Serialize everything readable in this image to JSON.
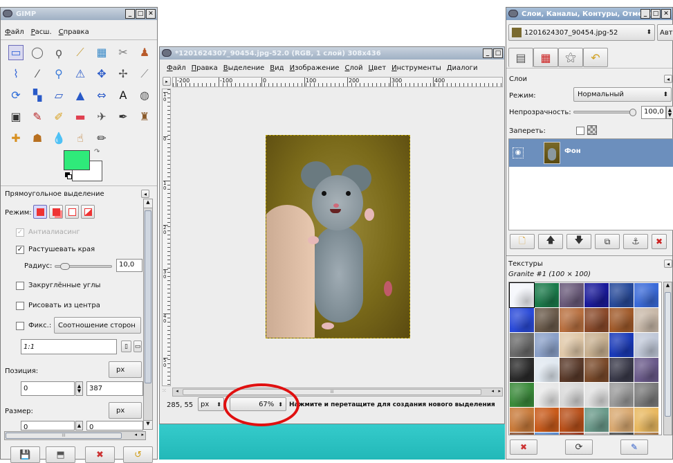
{
  "toolbox": {
    "title": "GIMP",
    "menu": [
      "Файл",
      "Расш.",
      "Справка"
    ],
    "tools": [
      [
        "rect-select-icon",
        "▭"
      ],
      [
        "ellipse-select-icon",
        "◯"
      ],
      [
        "free-select-icon",
        "ϙ"
      ],
      [
        "fuzzy-select-icon",
        "⟋"
      ],
      [
        "color-select-icon",
        "▦"
      ],
      [
        "scissors-icon",
        "✂"
      ],
      [
        "foreground-select-icon",
        "♟"
      ],
      [
        "paths-icon",
        "⌇"
      ],
      [
        "color-picker-icon",
        "⁄"
      ],
      [
        "zoom-icon",
        "⚲"
      ],
      [
        "measure-icon",
        "⚠"
      ],
      [
        "move-icon",
        "✥"
      ],
      [
        "align-icon",
        "✢"
      ],
      [
        "crop-icon",
        "⟋"
      ],
      [
        "rotate-icon",
        "⟳"
      ],
      [
        "scale-icon",
        "▚"
      ],
      [
        "shear-icon",
        "▱"
      ],
      [
        "perspective-icon",
        "▲"
      ],
      [
        "flip-icon",
        "⇔"
      ],
      [
        "text-icon",
        "A"
      ],
      [
        "bucket-fill-icon",
        "◍"
      ],
      [
        "blend-icon",
        "▣"
      ],
      [
        "pencil-icon",
        "✎"
      ],
      [
        "paintbrush-icon",
        "✐"
      ],
      [
        "eraser-icon",
        "▬"
      ],
      [
        "airbrush-icon",
        "✈"
      ],
      [
        "ink-icon",
        "✒"
      ],
      [
        "clone-icon",
        "♜"
      ],
      [
        "heal-icon",
        "✚"
      ],
      [
        "perspective-clone-icon",
        "☗"
      ],
      [
        "blur-icon",
        "💧"
      ],
      [
        "smudge-icon",
        "☝"
      ],
      [
        "dodge-burn-icon",
        "✏"
      ]
    ],
    "fg_color": "#2fea7a",
    "bg_color": "#ffffff"
  },
  "tool_options": {
    "title": "Прямоугольное выделение",
    "mode_label": "Режим:",
    "antialias_label": "Антиалиасинг",
    "feather_label": "Растушевать края",
    "radius_label": "Радиус:",
    "radius_value": "10,0",
    "radius_fraction": 0.1,
    "rounded_label": "Закруглённые углы",
    "from_center_label": "Рисовать из центра",
    "fixed_label": "Фикс.:",
    "fixed_select": "Соотношение сторон",
    "ratio_value": "1:1",
    "position_label": "Позиция:",
    "position_unit": "px",
    "pos_x": "0",
    "pos_y": "387",
    "size_label": "Размер:",
    "size_unit": "px",
    "size_w": "0",
    "size_h": "0"
  },
  "image_window": {
    "title": "*1201624307_90454.jpg-52.0 (RGB, 1 слой) 308x436",
    "menu": [
      "Файл",
      "Правка",
      "Выделение",
      "Вид",
      "Изображение",
      "Слой",
      "Цвет",
      "Инструменты",
      "Диалоги"
    ],
    "hruler": [
      "-200",
      "-100",
      "0",
      "100",
      "200",
      "300",
      "400"
    ],
    "vruler": [
      "1 0",
      "0",
      "1 0",
      "2 0",
      "3 0",
      "4 0",
      "5 0"
    ],
    "coords": "285, 55",
    "unit": "px",
    "zoom": "67%",
    "status": "Нажмите и перетащите для создания нового выделения",
    "scroll_marker": "III"
  },
  "layers_dock": {
    "title": "Слои, Каналы, Контуры, Отменить",
    "image_select": "1201624307_90454.jpg-52",
    "auto_label": "Авто",
    "panel_title": "Слои",
    "mode_label": "Режим:",
    "mode_value": "Нормальный",
    "opacity_label": "Непрозрачность:",
    "opacity_value": "100,0",
    "opacity_fraction": 1.0,
    "lock_label": "Запереть:",
    "layer_name": "Фон"
  },
  "textures_dock": {
    "title": "Текстуры",
    "current": "Granite #1 (100 × 100)",
    "swatches": [
      "#f4f6fb",
      "#1a7a4a",
      "#6a5a7a",
      "#1a1a9a",
      "#274a9a",
      "#3a6ad8",
      "#2a4ad8",
      "#6a5a4a",
      "#b87040",
      "#8a4a2a",
      "#a05a2a",
      "#c8b8a8",
      "#6a6a6a",
      "#8aa0c8",
      "#e0c8a8",
      "#c8b090",
      "#1a3ab8",
      "#c0c8d8",
      "#2a2a2a",
      "#e0e8f0",
      "#5a3a2a",
      "#7a4a2a",
      "#3a3a4a",
      "#6a5a8a",
      "#3a8a3a",
      "#e8e8e8",
      "#d8d8d8",
      "#e0e0e0",
      "#9a9a9a",
      "#7a7a7a",
      "#c87a3a",
      "#c85a1a",
      "#b8501a",
      "#6a9a8a",
      "#d8a870",
      "#e8b860",
      "#8a5030",
      "#5a8acd",
      "#9a3a20",
      "#c0c0c0",
      "#4a4a4a",
      "#a87848"
    ]
  }
}
